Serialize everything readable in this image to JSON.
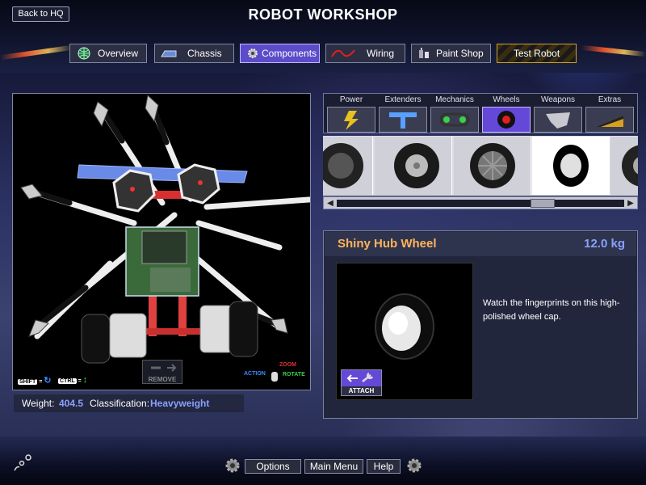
{
  "header": {
    "title": "ROBOT WORKSHOP",
    "back_label": "Back to HQ"
  },
  "tabs": [
    {
      "label": "Overview",
      "icon": "globe-icon"
    },
    {
      "label": "Chassis",
      "icon": "chassis-icon"
    },
    {
      "label": "Components",
      "icon": "gear-icon",
      "active": true
    },
    {
      "label": "Wiring",
      "icon": "wire-icon"
    },
    {
      "label": "Paint Shop",
      "icon": "paint-cans-icon"
    },
    {
      "label": "Test Robot",
      "icon": "hazard-stripes-icon"
    }
  ],
  "categories": [
    {
      "label": "Power",
      "icon": "lightning-icon"
    },
    {
      "label": "Extenders",
      "icon": "t-connector-icon"
    },
    {
      "label": "Mechanics",
      "icon": "chain-gear-icon"
    },
    {
      "label": "Wheels",
      "icon": "wheel-icon",
      "active": true
    },
    {
      "label": "Weapons",
      "icon": "blade-icon"
    },
    {
      "label": "Extras",
      "icon": "wedge-icon"
    }
  ],
  "viewport": {
    "shift_key": "SHIFT",
    "ctrl_key": "CTRL",
    "equals": "=",
    "remove_label": "REMOVE",
    "action_label": "ACTION",
    "zoom_label": "ZOOM",
    "rotate_label": "ROTATE"
  },
  "stats": {
    "weight_label": "Weight:",
    "weight_value": "404.5",
    "class_label": "Classification:",
    "class_value": "Heavyweight"
  },
  "selected_item": {
    "name": "Shiny Hub Wheel",
    "weight": "12.0 kg",
    "description": "Watch the fingerprints on this high-polished wheel cap.",
    "attach_label": "ATTACH"
  },
  "footer": {
    "options_label": "Options",
    "main_menu_label": "Main Menu",
    "help_label": "Help"
  },
  "colors": {
    "accent": "#6448d8",
    "item_name": "#ffb45a",
    "weight": "#8aa0ff"
  }
}
